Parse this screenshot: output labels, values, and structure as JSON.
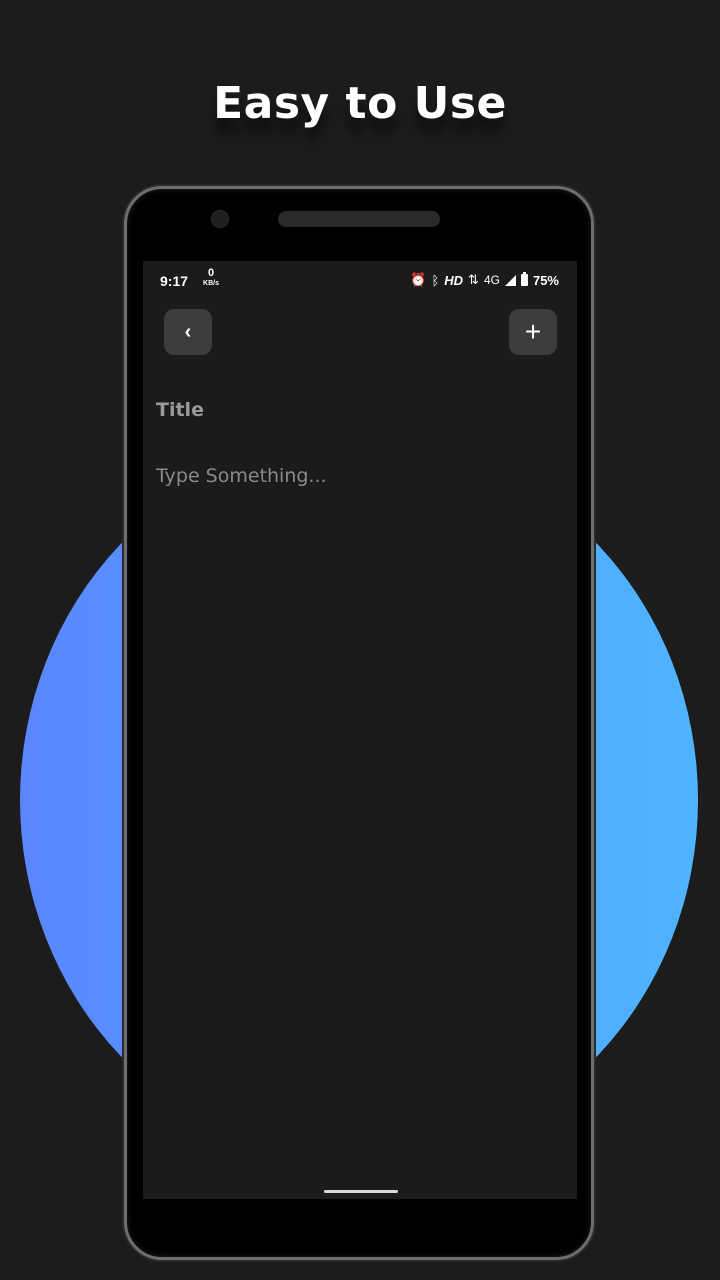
{
  "promo": {
    "headline": "Easy to Use"
  },
  "status_bar": {
    "time": "9:17",
    "net_speed_value": "0",
    "net_speed_unit": "KB/s",
    "alarm_icon": "alarm-icon",
    "bluetooth_icon": "bluetooth-icon",
    "hd_label": "HD",
    "arrows_glyph": "⇅",
    "network_label": "4G",
    "battery_percent": "75%"
  },
  "toolbar": {
    "back_glyph": "‹",
    "add_glyph": "+"
  },
  "editor": {
    "title_placeholder": "Title",
    "body_placeholder": "Type Something..."
  },
  "colors": {
    "background": "#1c1c1c",
    "screen": "#1b1b1b",
    "button": "#3d3d3d",
    "accent_gradient_start": "#5b86ff",
    "accent_gradient_end": "#4fb4ff"
  }
}
